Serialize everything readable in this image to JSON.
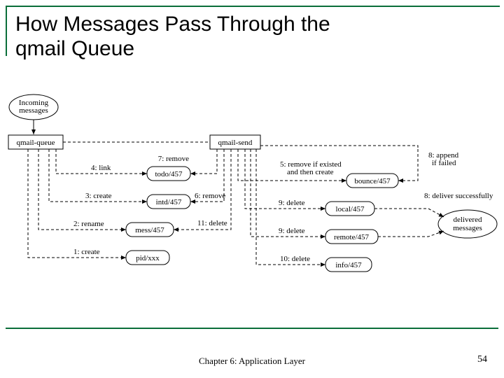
{
  "slide": {
    "title_line1": "How Messages Pass Through the",
    "title_line2": "qmail Queue",
    "footer": "Chapter 6: Application Layer",
    "page_number": "54"
  },
  "nodes": {
    "incoming": "Incoming\nmessages",
    "qmail_queue": "qmail-queue",
    "qmail_send": "qmail-send",
    "todo": "todo/457",
    "intd": "intd/457",
    "mess": "mess/457",
    "pid": "pid/xxx",
    "bounce": "bounce/457",
    "local": "local/457",
    "remote": "remote/457",
    "info": "info/457",
    "delivered": "delivered\nmessages"
  },
  "edges": {
    "e1": "1: create",
    "e2": "2: rename",
    "e3": "3: create",
    "e4": "4: link",
    "e5": "5: remove if existed\nand then create",
    "e6": "6: remove",
    "e7": "7: remove",
    "e8_app": "8: append\nif failed",
    "e8_del": "8: deliver successfully",
    "e9a": "9: delete",
    "e9b": "9: delete",
    "e10": "10: delete",
    "e11": "11: delete"
  }
}
